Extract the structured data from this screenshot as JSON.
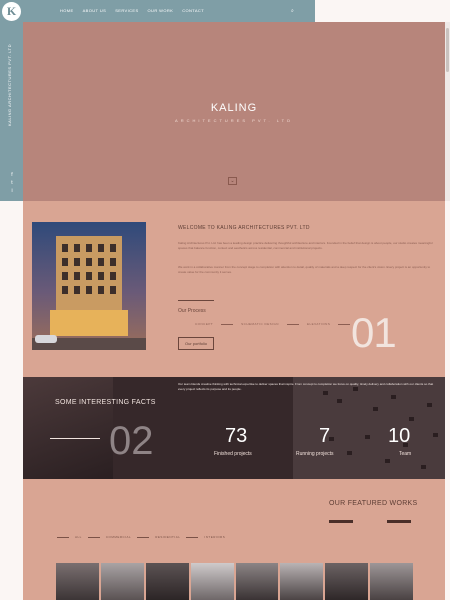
{
  "sidebar": {
    "logo_text": "K",
    "vertical_text": "KALING ARCHITECTURES PVT. LTD",
    "social": [
      "f",
      "t",
      "i"
    ]
  },
  "nav": {
    "items": [
      "HOME",
      "ABOUT US",
      "SERVICES",
      "OUR WORK",
      "CONTACT"
    ],
    "search_icon": "⌕"
  },
  "hero": {
    "title": "KALING",
    "subtitle": "ARCHITECTURES PVT. LTD",
    "arrow": "⌄"
  },
  "about": {
    "welcome": "WELCOME TO KALING ARCHITECTURES PVT. LTD",
    "para1": "Kaling Architectures Pvt. Ltd. has been a leading design practice delivering thoughtful architecture and interiors. Founded in the belief that design is about people, our studio creates meaningful spaces that balance function, context and aesthetics across residential, commercial and institutional projects.",
    "para2": "We work in a collaborative manner from the concept stage to completion with attention to detail, quality of materials and a deep respect for the client's vision. Every project is an opportunity to create value for the community it serves.",
    "process_label": "Our Process",
    "steps": [
      "CONCEPT",
      "SCHEMATIC DESIGN",
      "ELEVATIONS"
    ],
    "big_number": "01",
    "button_label": "Our portfolio"
  },
  "facts": {
    "title": "SOME INTERESTING FACTS",
    "text": "Our team blends creative thinking with technical expertise to deliver spaces that inspire. From concept to completion we focus on quality, timely delivery and collaboration with our clients so that every project reflects its purpose and its people.",
    "big_number": "02",
    "stats": [
      {
        "num": "73",
        "label": "Finished projects"
      },
      {
        "num": "7",
        "label": "Running projects"
      },
      {
        "num": "10",
        "label": "Team"
      }
    ]
  },
  "works": {
    "title": "OUR FEATURED WORKS",
    "filters": [
      "ALL",
      "COMMERCIAL",
      "RESIDENTIAL",
      "INTERIORS"
    ]
  },
  "colors": {
    "nav": "#7f9ea6",
    "hero": "#b7857b",
    "section": "#d9a593",
    "dark": "#36282a"
  }
}
